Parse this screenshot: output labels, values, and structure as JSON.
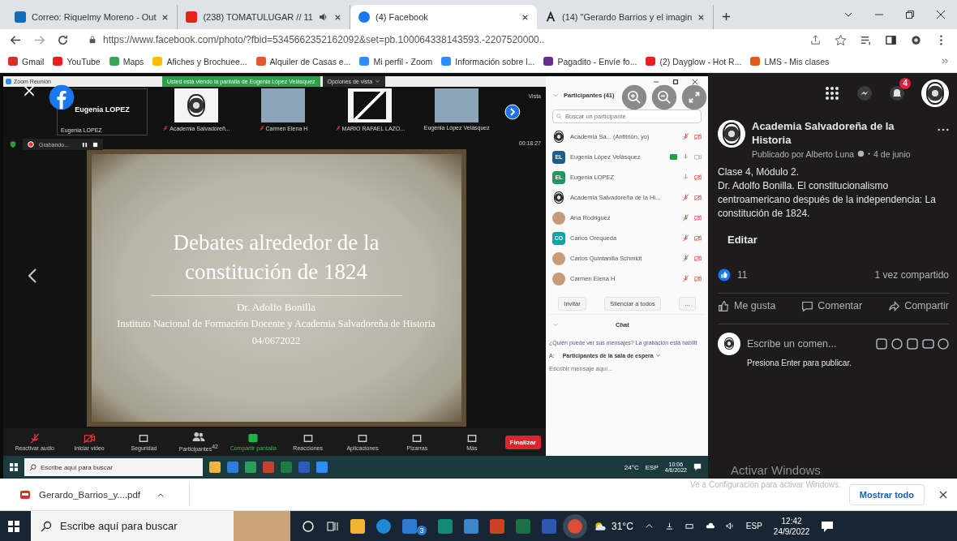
{
  "browser": {
    "tabs": [
      {
        "kind": "outlook",
        "label": "Correo: Riquelmy Moreno - Out",
        "selected": false,
        "audio": false
      },
      {
        "kind": "youtube",
        "label": "(238) TOMATULUGAR // 11",
        "selected": false,
        "audio": true
      },
      {
        "kind": "facebook",
        "label": "(4) Facebook",
        "selected": true,
        "audio": false
      },
      {
        "kind": "letter",
        "label": "(14) \"Gerardo Barrios y el imagin",
        "selected": false,
        "audio": false
      }
    ],
    "url": "https://www.facebook.com/photo/?fbid=5345662352162092&set=pb.100064338143593.-2207520000..",
    "bookmarks": [
      {
        "kind": "gmail",
        "label": "Gmail"
      },
      {
        "kind": "youtube",
        "label": "YouTube"
      },
      {
        "kind": "maps",
        "label": "Maps"
      },
      {
        "kind": "drive",
        "label": "Afiches y Brochuee..."
      },
      {
        "kind": "house",
        "label": "Alquiler de Casas e..."
      },
      {
        "kind": "zoom",
        "label": "Mi perfil - Zoom"
      },
      {
        "kind": "zoom",
        "label": "Información sobre l..."
      },
      {
        "kind": "pagadito",
        "label": "Pagadito - Envíe fo..."
      },
      {
        "kind": "youtube",
        "label": "(2) Dayglow - Hot R..."
      },
      {
        "kind": "lms",
        "label": "LMS - Mis clases"
      }
    ]
  },
  "zoom": {
    "title": "Zoom Reunión",
    "banner": "Usted está viendo la pantalla de Eugenia López Velásquez",
    "view_options": "Opciones de vista",
    "speaker": "Eugenia LOPEZ",
    "speaker_label": "Eugenia LOPEZ",
    "thumbnails": [
      {
        "kind": "logo",
        "label": "Academia Salvadoreñ...",
        "muted": true
      },
      {
        "kind": "photo",
        "label": "Carmen Elena H",
        "muted": true
      },
      {
        "kind": "artwork",
        "label": "MARIO RAFAEL LAZO...",
        "muted": true
      },
      {
        "kind": "photo",
        "label": "Eugenia López Velásquez",
        "muted": false
      }
    ],
    "view": "Vista",
    "recording": "Grabando...",
    "timer": "00:18:27",
    "slide": {
      "title": "Debates alrededor de la constitución de 1824",
      "author": "Dr. Adolfo Bonilla",
      "institution": "Instituto Nacional de Formación Docente y Academia Salvadoreña de Historia",
      "date": "04/0672022"
    },
    "toolbar": [
      {
        "kind": "audio",
        "label": "Reactivar audio"
      },
      {
        "kind": "video",
        "label": "Iniciar video"
      },
      {
        "kind": "security",
        "label": "Seguridad"
      },
      {
        "kind": "participants",
        "label": "Participantes",
        "count": "42"
      },
      {
        "kind": "share",
        "label": "Compartir pantalla"
      },
      {
        "kind": "reactions",
        "label": "Reacciones"
      },
      {
        "kind": "apps",
        "label": "Aplicaciones"
      },
      {
        "kind": "whiteboard",
        "label": "Pizarras"
      },
      {
        "kind": "more",
        "label": "Más"
      }
    ],
    "end": "Finalizar",
    "panel": {
      "title": "Participantes (41)",
      "search_placeholder": "Buscar un participante",
      "participants": [
        {
          "kind": "logo",
          "name": "Academia Sa... (Anfitrión, yo)",
          "muted": true,
          "video_off": true,
          "sharing": false
        },
        {
          "kind": "initials",
          "initials": "EL",
          "color": "#1f5c86",
          "name": "Eugenia López Velásquez",
          "muted": false,
          "video_off": false,
          "sharing": true
        },
        {
          "kind": "initials",
          "initials": "EL",
          "color": "#1e9a5c",
          "name": "Eugenia LOPEZ",
          "muted": false,
          "video_off": true,
          "sharing": false
        },
        {
          "kind": "logo",
          "name": "Academia Salvadoreña de la Hi...",
          "muted": true,
          "video_off": true,
          "sharing": false
        },
        {
          "kind": "photo",
          "name": "Ana Rodriguez",
          "muted": true,
          "video_off": true,
          "sharing": false
        },
        {
          "kind": "initials",
          "initials": "CO",
          "color": "#14a0a4",
          "name": "Carlos Orequeda",
          "muted": true,
          "video_off": true,
          "sharing": false
        },
        {
          "kind": "photo",
          "name": "Carlos Quintanilla Schmidt",
          "muted": true,
          "video_off": true,
          "sharing": false
        },
        {
          "kind": "photo",
          "name": "Carmen Elena H",
          "muted": true,
          "video_off": true,
          "sharing": false
        }
      ],
      "invite": "Invitar",
      "mute_all": "Silenciar a todos",
      "more": "...",
      "chat": "Chat",
      "notice": "¿Quién puede ver sus mensajes? La grabación está habilit",
      "to": "A:",
      "recipient": "Participantes de la sala de espera",
      "message_placeholder": "Escribir mensaje aquí..."
    },
    "taskbar": {
      "search": "Escribe aquí para buscar",
      "temp": "24°C",
      "lang": "ESP",
      "time": "10:06",
      "date": "4/6/2022"
    }
  },
  "windows_notice": {
    "title": "Activar Windows",
    "text": "Ve a Configuración para activar Windows."
  },
  "post": {
    "notifications": "4",
    "page": "Academia Salvadoreña de la Historia",
    "byline": "Publicado por Alberto Luna",
    "date": "4 de junio",
    "paragraphs": [
      "Clase 4, Módulo 2.",
      "Dr. Adolfo Bonilla. El constitucionalismo centroamericano después de la independencia: La constitución de 1824."
    ],
    "edit": "Editar",
    "likes": "11",
    "shares": "1 vez compartido",
    "actions": [
      {
        "kind": "like",
        "label": "Me gusta"
      },
      {
        "kind": "comment",
        "label": "Comentar"
      },
      {
        "kind": "share",
        "label": "Compartir"
      }
    ],
    "comment_placeholder": "Escribe un comen...",
    "hint": "Presiona Enter para publicar."
  },
  "downloads": {
    "file": "Gerardo_Barrios_y....pdf",
    "show_all": "Mostrar todo"
  },
  "taskbar": {
    "search": "Escribe aquí para buscar",
    "mail_badge": "3",
    "temp": "31°C",
    "lang": "ESP",
    "time": "12:42",
    "date": "24/9/2022"
  }
}
